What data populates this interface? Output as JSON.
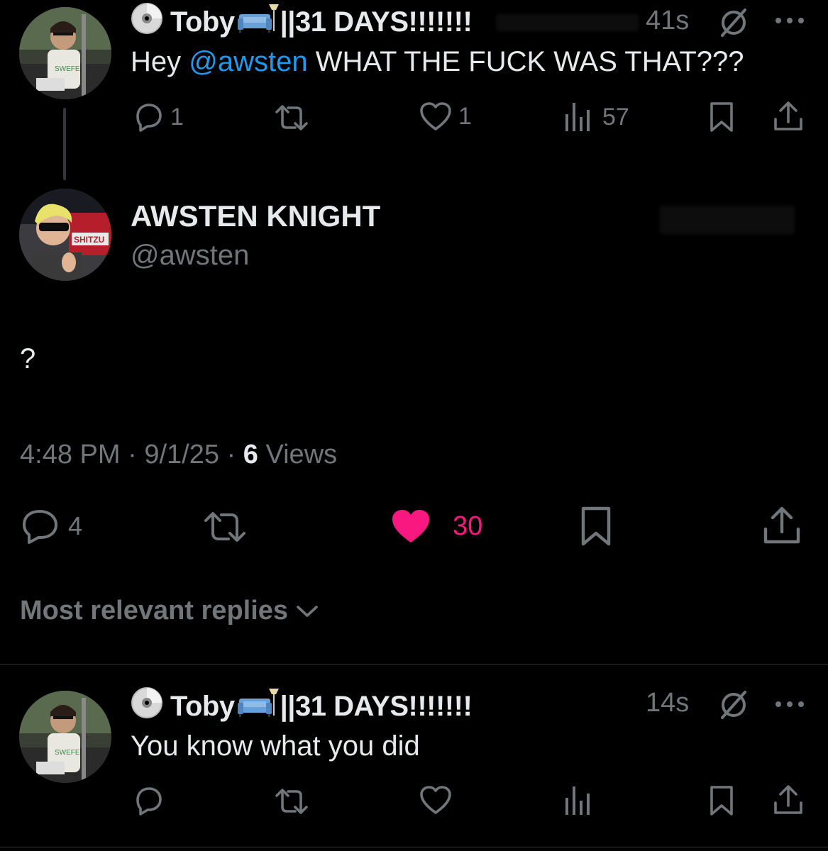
{
  "reply1": {
    "name": "Toby",
    "name_suffix": "||31 DAYS!!!!!!!",
    "time": "41s",
    "text_prefix": "Hey ",
    "mention": "@awsten",
    "text_suffix": " WHAT THE FUCK WAS THAT???",
    "replies": "1",
    "likes": "1",
    "views": "57"
  },
  "main": {
    "name": "AWSTEN KNIGHT",
    "handle": "@awsten",
    "text": "?",
    "time": "4:48 PM",
    "date": "9/1/25",
    "views_count": "6",
    "views_label": "Views",
    "replies": "4",
    "likes": "30",
    "sort_label": "Most relevant replies"
  },
  "reply2": {
    "name": "Toby",
    "name_suffix": "||31 DAYS!!!!!!!",
    "time": "14s",
    "text": "You know what you did"
  },
  "colors": {
    "background": "#000000",
    "text": "#e7e9ea",
    "muted": "#71767b",
    "link": "#1d9bf0",
    "like": "#f91880"
  }
}
